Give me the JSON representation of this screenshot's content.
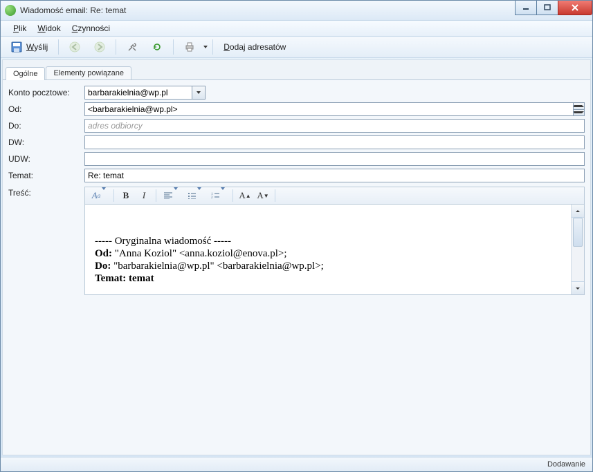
{
  "window": {
    "title": "Wiadomość email: Re: temat"
  },
  "menu": {
    "plik": "Plik",
    "widok": "Widok",
    "czynnosci": "Czynności"
  },
  "toolbar": {
    "send_label": "Wyślij",
    "add_recipients_label": "Dodaj adresatów"
  },
  "tabs": {
    "general": "Ogólne",
    "related": "Elementy powiązane"
  },
  "form": {
    "account_label": "Konto pocztowe:",
    "account_value": "barbarakielnia@wp.pl",
    "from_label": "Od:",
    "from_value": " <barbarakielnia@wp.pl>",
    "to_label": "Do:",
    "to_placeholder": "adres odbiorcy",
    "to_value": "",
    "cc_label": "DW:",
    "cc_value": "",
    "bcc_label": "UDW:",
    "bcc_value": "",
    "subject_label": "Temat:",
    "subject_value": "Re: temat",
    "body_label": "Treść:"
  },
  "editor": {
    "intro": "----- Oryginalna wiadomość -----",
    "from_label": "Od:",
    "from_value": " \"Anna Koziol\" <anna.koziol@enova.pl>;",
    "to_label": "Do:",
    "to_value": " \"barbarakielnia@wp.pl\" <barbarakielnia@wp.pl>;",
    "subject_label": "Temat: temat"
  },
  "status": {
    "text": "Dodawanie"
  }
}
